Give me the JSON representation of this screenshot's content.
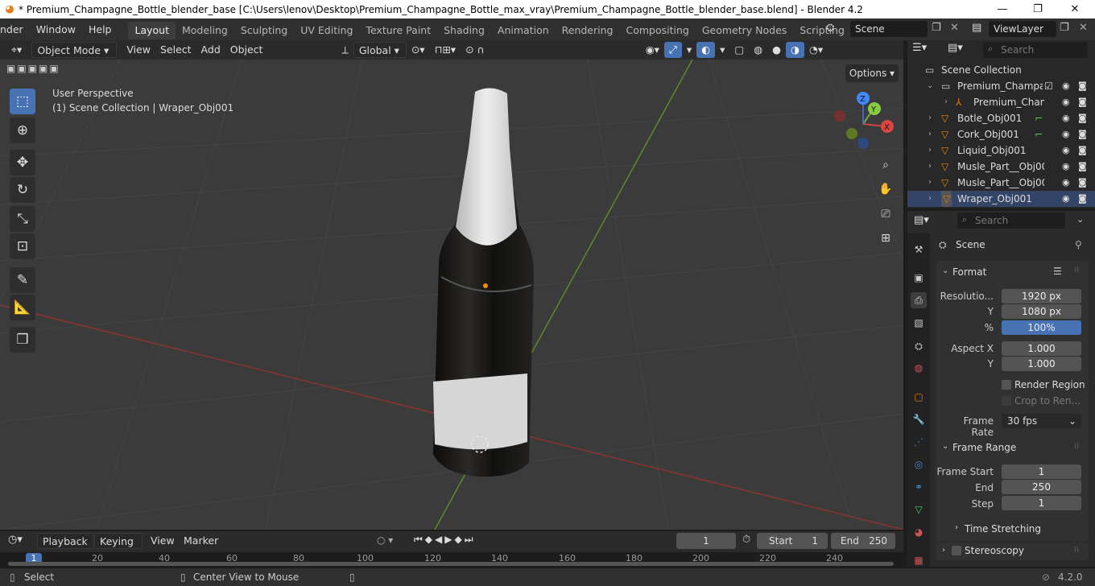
{
  "title_bar": {
    "text": "* Premium_Champagne_Bottle_blender_base [C:\\Users\\lenov\\Desktop\\Premium_Champagne_Bottle_max_vray\\Premium_Champagne_Bottle_blender_base.blend] - Blender 4.2",
    "minimize": "—",
    "maximize": "❐",
    "close": "✕"
  },
  "menus": [
    "nder",
    "Window",
    "Help"
  ],
  "workspaces": [
    {
      "label": "Layout",
      "active": true
    },
    {
      "label": "Modeling"
    },
    {
      "label": "Sculpting"
    },
    {
      "label": "UV Editing"
    },
    {
      "label": "Texture Paint"
    },
    {
      "label": "Shading"
    },
    {
      "label": "Animation"
    },
    {
      "label": "Rendering"
    },
    {
      "label": "Compositing"
    },
    {
      "label": "Geometry Nodes"
    },
    {
      "label": "Scripting"
    }
  ],
  "add_workspace": "+",
  "scene": {
    "label": "Scene"
  },
  "view_layer": {
    "label": "ViewLayer"
  },
  "viewport_header": {
    "mode": "Object Mode",
    "menus": [
      "View",
      "Select",
      "Add",
      "Object"
    ],
    "transform_orientation": "Global",
    "options": "Options"
  },
  "viewport": {
    "perspective": "User Perspective",
    "collection_info": "(1) Scene Collection | Wraper_Obj001",
    "gizmo": {
      "x": "X",
      "y": "Y",
      "z": "Z"
    }
  },
  "outliner": {
    "search_placeholder": "Search",
    "root": "Scene Collection",
    "rows": [
      {
        "label": "Premium_Champag",
        "indent": 1
      },
      {
        "label": "Premium_Cham",
        "indent": 2
      },
      {
        "label": "Botle_Obj001",
        "indent": 1
      },
      {
        "label": "Cork_Obj001",
        "indent": 1
      },
      {
        "label": "Liquid_Obj001",
        "indent": 1
      },
      {
        "label": "Musle_Part__Obj00",
        "indent": 1
      },
      {
        "label": "Musle_Part__Obj00",
        "indent": 1
      },
      {
        "label": "Wraper_Obj001",
        "indent": 1
      }
    ]
  },
  "properties": {
    "search_placeholder": "Search",
    "context": "Scene",
    "format": {
      "title": "Format",
      "resolution_x_label": "Resolutio...",
      "resolution_x": "1920 px",
      "resolution_y_label": "Y",
      "resolution_y": "1080 px",
      "percent_label": "%",
      "percent": "100%",
      "aspect_x_label": "Aspect X",
      "aspect_x": "1.000",
      "aspect_y_label": "Y",
      "aspect_y": "1.000",
      "render_region": "Render Region",
      "crop": "Crop to Ren...",
      "frame_rate_label": "Frame Rate",
      "frame_rate": "30 fps"
    },
    "frame_range": {
      "title": "Frame Range",
      "start_label": "Frame Start",
      "start": "1",
      "end_label": "End",
      "end": "250",
      "step_label": "Step",
      "step": "1"
    },
    "time_stretching": "Time Stretching",
    "stereoscopy": "Stereoscopy"
  },
  "timeline": {
    "menus": [
      "Playback",
      "Keying",
      "View",
      "Marker"
    ],
    "current_frame": "1",
    "start_label": "Start",
    "start": "1",
    "end_label": "End",
    "end": "250",
    "ruler": [
      "1",
      "20",
      "40",
      "60",
      "80",
      "100",
      "120",
      "140",
      "160",
      "180",
      "200",
      "220",
      "240"
    ]
  },
  "status_bar": {
    "select": "Select",
    "center_view": "Center View to Mouse",
    "version": "4.2.0"
  },
  "colors": {
    "accent": "#4772b3",
    "object_orange": "#e87d0d",
    "x_axis": "#b83a3a",
    "y_axis": "#6a9a2a"
  }
}
